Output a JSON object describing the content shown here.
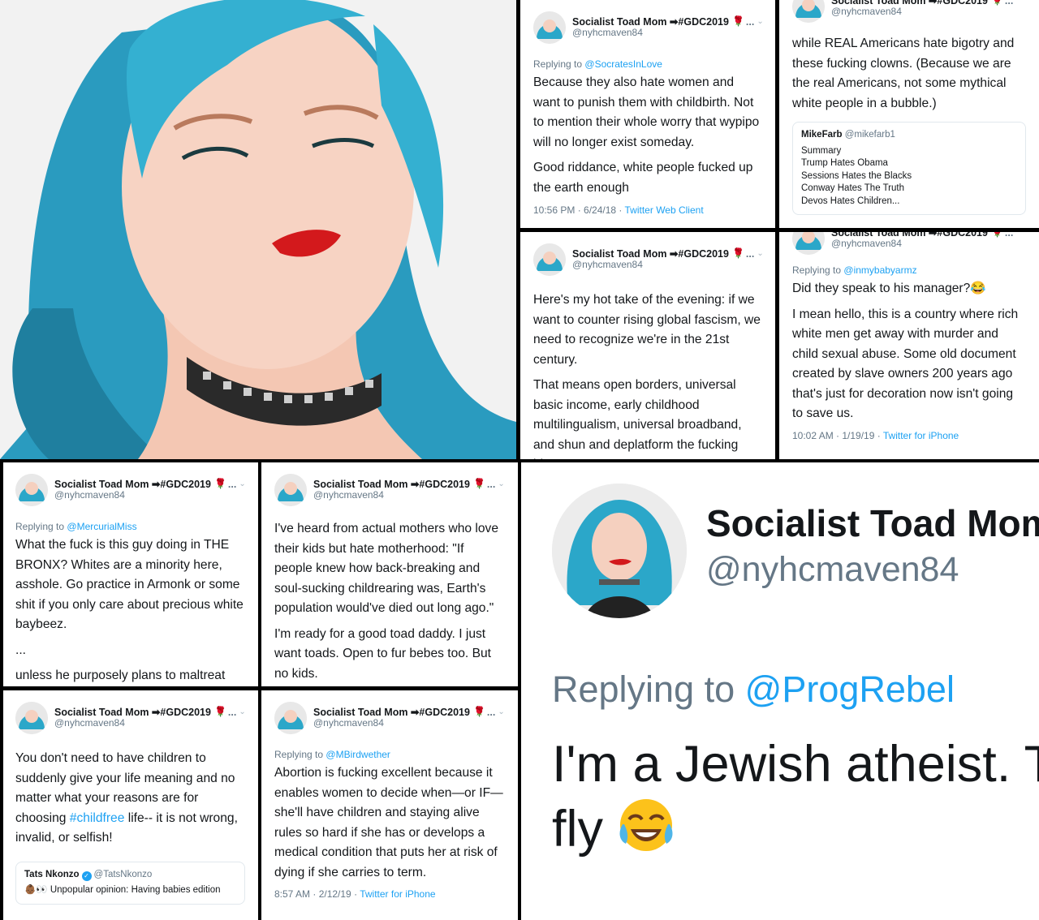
{
  "profile": {
    "name": "Socialist Toad Mom",
    "name_suffix": "#GDC2019",
    "more": "...",
    "handle": "@nyhcmaven84"
  },
  "tweets": [
    {
      "replying_prefix": "Replying to",
      "replying_to": "@SocratesInLove",
      "paragraphs": [
        "Because they also hate women and want to punish them with childbirth. Not to mention their whole worry that wypipo will no longer exist someday.",
        "Good riddance, white people fucked up the earth enough"
      ],
      "time": "10:56 PM · 6/24/18 · ",
      "client": "Twitter Web Client"
    },
    {
      "paragraphs": [
        "while REAL Americans hate bigotry and these fucking clowns. (Because we are the real Americans, not some mythical white people in a bubble.)"
      ],
      "quote": {
        "name": "MikeFarb",
        "handle": "@mikefarb1",
        "lines": [
          "Summary",
          "Trump Hates Obama",
          "Sessions Hates the Blacks",
          "Conway Hates The Truth",
          "Devos Hates Children..."
        ]
      }
    },
    {
      "paragraphs": [
        "Here's my hot take of the evening: if we want to counter rising global fascism, we need to recognize we're in the 21st century.",
        "That means open borders, universal basic income, early childhood multilingualism, universal broadband, and shun and deplatform the fucking bigots."
      ]
    },
    {
      "replying_prefix": "Replying to",
      "replying_to": "@inmybabyarmz",
      "paragraphs": [
        "Did they speak to his manager?😂",
        "I mean hello, this is a country where rich white men get away with murder and child sexual abuse. Some old document created by slave owners 200 years ago that's just for decoration now isn't going to save us."
      ],
      "time": "10:02 AM · 1/19/19 · ",
      "client": "Twitter for iPhone"
    },
    {
      "replying_prefix": "Replying to",
      "replying_to": "@MercurialMiss",
      "paragraphs": [
        "What the fuck is this guy doing in THE BRONX? Whites are a minority here, asshole. Go practice in Armonk or some shit if you only care about precious white baybeez.",
        "...",
        "unless he purposely plans to maltreat minorities second I'm very glad I go to"
      ]
    },
    {
      "paragraphs": [
        "I've heard from actual mothers who love their kids but hate motherhood: \"If people knew how back-breaking and soul-sucking childrearing was, Earth's population would've died out long ago.\"",
        "I'm ready for a good toad daddy. I just want toads. Open to fur bebes too. But no kids."
      ]
    },
    {
      "paragraphs_rich": {
        "before": "You don't need to have children to suddenly give your life meaning and no matter what your reasons are for choosing ",
        "tag": "#childfree",
        "after": " life-- it is not wrong, invalid, or selfish!"
      },
      "quote": {
        "name": "Tats Nkonzo",
        "handle": "@TatsNkonzo",
        "lines": [
          "👶🏾👀 Unpopular opinion: Having babies edition"
        ]
      }
    },
    {
      "replying_prefix": "Replying to",
      "replying_to": "@MBirdwether",
      "paragraphs": [
        "Abortion is fucking excellent because it enables women to decide when—or IF—she'll have children and staying alive rules so hard if she has or develops a medical condition that puts her at risk of dying if she carries to term."
      ],
      "time": "8:57 AM · 2/12/19 · ",
      "client": "Twitter for iPhone"
    }
  ],
  "zoom": {
    "name": "Socialist Toad Mom",
    "handle": "@nyhcmaven84",
    "replying_prefix": "Replying to ",
    "replying_to": "@ProgRebel",
    "line1": "I'm a Jewish atheist. T",
    "line2": "fly",
    "emoji": "joy-face-emoji"
  },
  "colors": {
    "link": "#1da1f2",
    "muted": "#657786",
    "text": "#14171a",
    "hair": "#2ba7c9",
    "lips": "#d3191c"
  },
  "icons": [
    "rose-icon",
    "soon-arrow-icon",
    "chevron-down-icon",
    "verified-icon",
    "joy-face-emoji"
  ]
}
